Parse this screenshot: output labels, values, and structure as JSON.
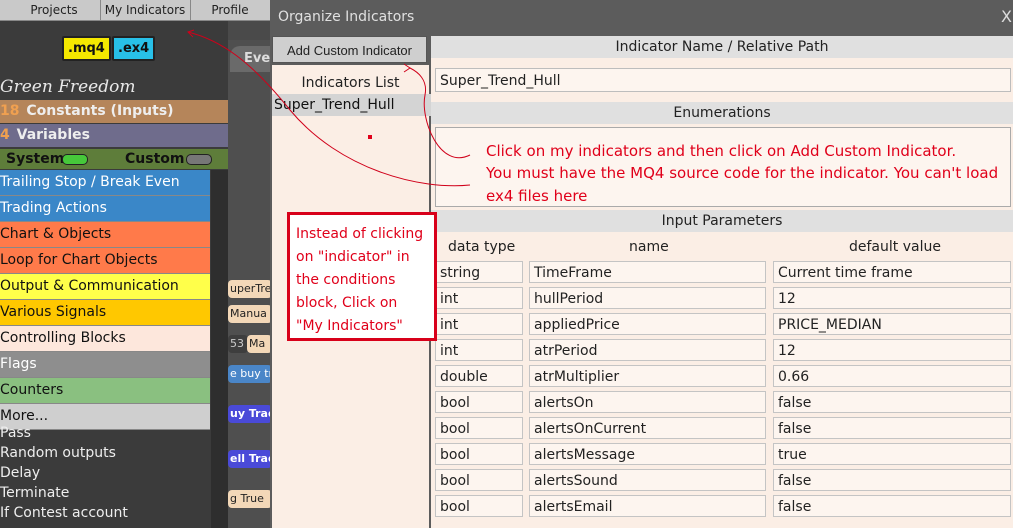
{
  "top_tabs": [
    "Projects",
    "My Indicators",
    "Profile"
  ],
  "badges": {
    "mq4": ".mq4",
    "ex4": ".ex4"
  },
  "left_panel": {
    "brand": "Green Freedom",
    "constants": {
      "num": "18",
      "label": "Constants (Inputs)"
    },
    "variables": {
      "num": "4",
      "label": "Variables"
    },
    "system_label": "System",
    "custom_label": "Custom",
    "categories": [
      {
        "label": "Trailing Stop / Break Even",
        "color": "#3a87c8"
      },
      {
        "label": "Trading Actions",
        "color": "#3a87c8"
      },
      {
        "label": "Chart & Objects",
        "color": "#ff7a4a"
      },
      {
        "label": "Loop for Chart Objects",
        "color": "#ff7a4a"
      },
      {
        "label": "Output & Communication",
        "color": "#ffff4a"
      },
      {
        "label": "Various Signals",
        "color": "#ffc800"
      },
      {
        "label": "Controlling Blocks",
        "color": "#fde7dc"
      },
      {
        "label": "Flags",
        "color": "#8e8e8e"
      },
      {
        "label": "Counters",
        "color": "#8ac080"
      },
      {
        "label": "More...",
        "color": "#cfcfcf"
      }
    ],
    "plain_items": [
      "Pass",
      "Random outputs",
      "Delay",
      "Terminate",
      "If Contest account"
    ]
  },
  "canvas_chips": [
    "Eve",
    "uperTre",
    "Manua",
    "53",
    "Ma",
    "e buy tr",
    "uy Trade",
    "ell Trade",
    "g True"
  ],
  "dialog": {
    "title": "Organize Indicators",
    "close": "X",
    "add_button": "Add Custom Indicator",
    "list_header": "Indicators List",
    "list_items": [
      "Super_Trend_Hull"
    ],
    "name_header": "Indicator Name / Relative Path",
    "name_value": "Super_Trend_Hull",
    "enum_header": "Enumerations",
    "params_header": "Input Parameters",
    "columns": [
      "data type",
      "name",
      "default value"
    ],
    "params": [
      {
        "type": "string",
        "name": "TimeFrame",
        "default": "Current time frame"
      },
      {
        "type": "int",
        "name": "hullPeriod",
        "default": "12"
      },
      {
        "type": "int",
        "name": "appliedPrice",
        "default": "PRICE_MEDIAN"
      },
      {
        "type": "int",
        "name": "atrPeriod",
        "default": "12"
      },
      {
        "type": "double",
        "name": "atrMultiplier",
        "default": "0.66"
      },
      {
        "type": "bool",
        "name": "alertsOn",
        "default": "false"
      },
      {
        "type": "bool",
        "name": "alertsOnCurrent",
        "default": "false"
      },
      {
        "type": "bool",
        "name": "alertsMessage",
        "default": "true"
      },
      {
        "type": "bool",
        "name": "alertsSound",
        "default": "false"
      },
      {
        "type": "bool",
        "name": "alertsEmail",
        "default": "false"
      }
    ]
  },
  "annotations": {
    "note1": [
      "Click on my indicators and then click on Add Custom Indicator.",
      "You must have the MQ4 source code for the indicator. You can't load",
      "ex4 files here"
    ],
    "note2": [
      "Instead of clicking",
      "on \"indicator\" in",
      "the conditions",
      "block, Click on",
      "\"My Indicators\""
    ]
  },
  "colors": {
    "annotation_red": "#e0001a",
    "dialog_bg": "#5c5c5c",
    "panel_bg": "#fbeee5"
  }
}
